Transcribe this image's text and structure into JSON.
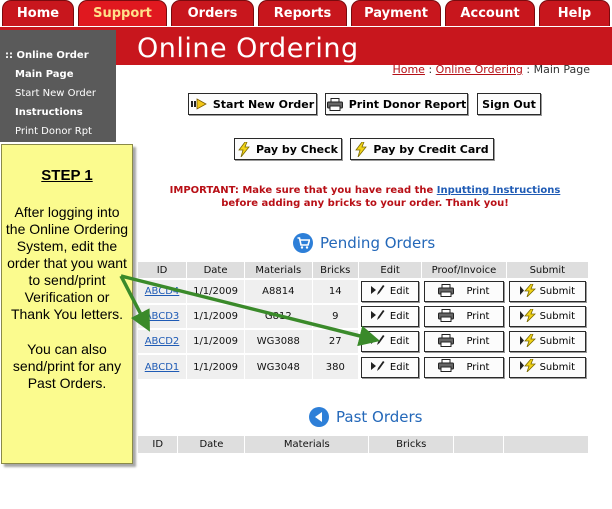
{
  "nav": {
    "tabs": [
      {
        "label": "Home"
      },
      {
        "label": "Support"
      },
      {
        "label": "Orders"
      },
      {
        "label": "Reports"
      },
      {
        "label": "Payment"
      },
      {
        "label": "Account"
      },
      {
        "label": "Help"
      }
    ]
  },
  "sidebar": {
    "items": [
      {
        "label": ":: Online Order"
      },
      {
        "label": "Main Page"
      },
      {
        "label": "Start New Order"
      },
      {
        "label": "Instructions"
      },
      {
        "label": "Print Donor Rpt"
      }
    ]
  },
  "header": {
    "title": "Online Ordering",
    "breadcrumb": [
      "Home",
      "Online Ordering",
      "Main Page"
    ],
    "breadcrumb_sep": " : "
  },
  "actions": {
    "start_new_order": "Start New Order",
    "print_donor_report": "Print Donor Report",
    "sign_out": "Sign Out",
    "pay_by_check": "Pay by Check",
    "pay_by_credit_card": "Pay by Credit Card"
  },
  "notice": {
    "prefix": "IMPORTANT:  Make sure that you have read the ",
    "link": "Inputting Instructions",
    "suffix": "before adding any bricks to your order. Thank you!"
  },
  "pending": {
    "title": "Pending Orders",
    "headers": [
      "ID",
      "Date",
      "Materials",
      "Bricks",
      "Edit",
      "Proof/Invoice",
      "Submit"
    ],
    "edit_label": "Edit",
    "print_label": "Print",
    "submit_label": "Submit",
    "rows": [
      {
        "id": "ABCD4",
        "date": "1/1/2009",
        "materials": "A8814",
        "bricks": "14"
      },
      {
        "id": "ABCD3",
        "date": "1/1/2009",
        "materials": "G812",
        "bricks": "9"
      },
      {
        "id": "ABCD2",
        "date": "1/1/2009",
        "materials": "WG3088",
        "bricks": "27"
      },
      {
        "id": "ABCD1",
        "date": "1/1/2009",
        "materials": "WG3048",
        "bricks": "380"
      }
    ]
  },
  "past": {
    "title": "Past Orders",
    "headers": [
      "ID",
      "Date",
      "Materials",
      "Bricks",
      "",
      ""
    ]
  },
  "callout": {
    "step": "STEP 1",
    "text": "After logging into the Online Ordering System, edit the order that you want to send/print Verification or Thank You letters.",
    "text2": "You can also send/print for any Past Orders."
  },
  "colors": {
    "brand_red": "#c8161d",
    "sidebar_gray": "#5a5a5a",
    "link_blue": "#1f5bb5",
    "heading_blue": "#2468b9",
    "callout_yellow": "#fbfb8e",
    "arrow_green": "#3a8a2a"
  },
  "icons": {
    "start_new_order": "play-arrow-icon",
    "print_donor_report": "printer-icon",
    "pay_by_check": "lightning-icon",
    "pay_by_credit_card": "lightning-icon",
    "pending_orders": "cart-icon",
    "past_orders": "back-arrow-icon",
    "edit": "pencil-icon",
    "print": "printer-icon",
    "submit": "lightning-icon"
  }
}
